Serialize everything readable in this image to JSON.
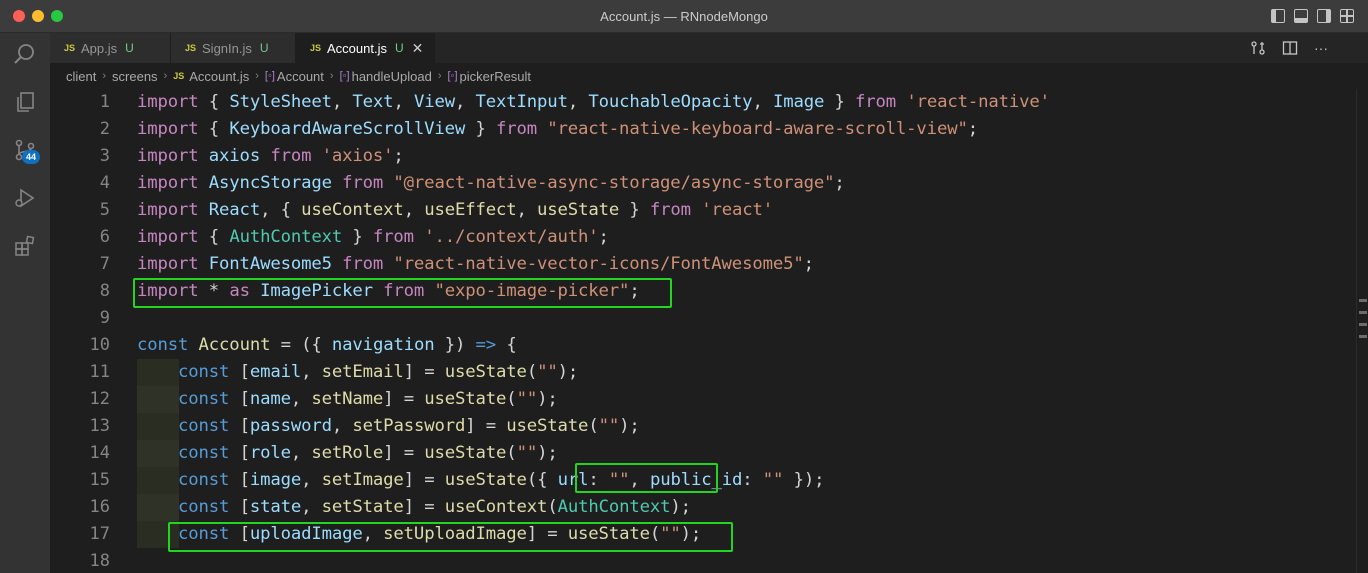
{
  "window": {
    "title": "Account.js — RNnodeMongo"
  },
  "activity_bar": {
    "items": [
      "explorer-icon",
      "search-icon",
      "files-icon",
      "source-control-icon",
      "run-debug-icon",
      "extensions-icon"
    ],
    "source_control_badge": "44"
  },
  "tabs": [
    {
      "icon": "JS",
      "label": "App.js",
      "status": "U"
    },
    {
      "icon": "JS",
      "label": "SignIn.js",
      "status": "U"
    },
    {
      "icon": "JS",
      "label": "Account.js",
      "status": "U",
      "close": "✕"
    }
  ],
  "breadcrumb": {
    "items": [
      "client",
      "screens",
      "Account.js",
      "Account",
      "handleUpload",
      "pickerResult"
    ]
  },
  "editor": {
    "line_numbers": [
      "1",
      "2",
      "3",
      "4",
      "5",
      "6",
      "7",
      "8",
      "9",
      "10",
      "11",
      "12",
      "13",
      "14",
      "15",
      "16",
      "17",
      "18"
    ],
    "lines": [
      "import { StyleSheet, Text, View, TextInput, TouchableOpacity, Image } from 'react-native'",
      "import { KeyboardAwareScrollView } from \"react-native-keyboard-aware-scroll-view\";",
      "import axios from 'axios';",
      "import AsyncStorage from \"@react-native-async-storage/async-storage\";",
      "import React, { useContext, useEffect, useState } from 'react'",
      "import { AuthContext } from '../context/auth';",
      "import FontAwesome5 from \"react-native-vector-icons/FontAwesome5\";",
      "import * as ImagePicker from \"expo-image-picker\";",
      "",
      "const Account = ({ navigation }) => {",
      "    const [email, setEmail] = useState(\"\");",
      "    const [name, setName] = useState(\"\");",
      "    const [password, setPassword] = useState(\"\");",
      "    const [role, setRole] = useState(\"\");",
      "    const [image, setImage] = useState({ url: \"\", public_id: \"\" });",
      "    const [state, setState] = useContext(AuthContext);",
      "    const [uploadImage, setUploadImage] = useState(\"\");",
      ""
    ]
  },
  "colors": {
    "highlight_box": "#23d423",
    "keyword": "#569cd6",
    "string": "#ce9178",
    "variable": "#9cdcfe",
    "function": "#dcdcaa",
    "type": "#4ec9b0"
  }
}
